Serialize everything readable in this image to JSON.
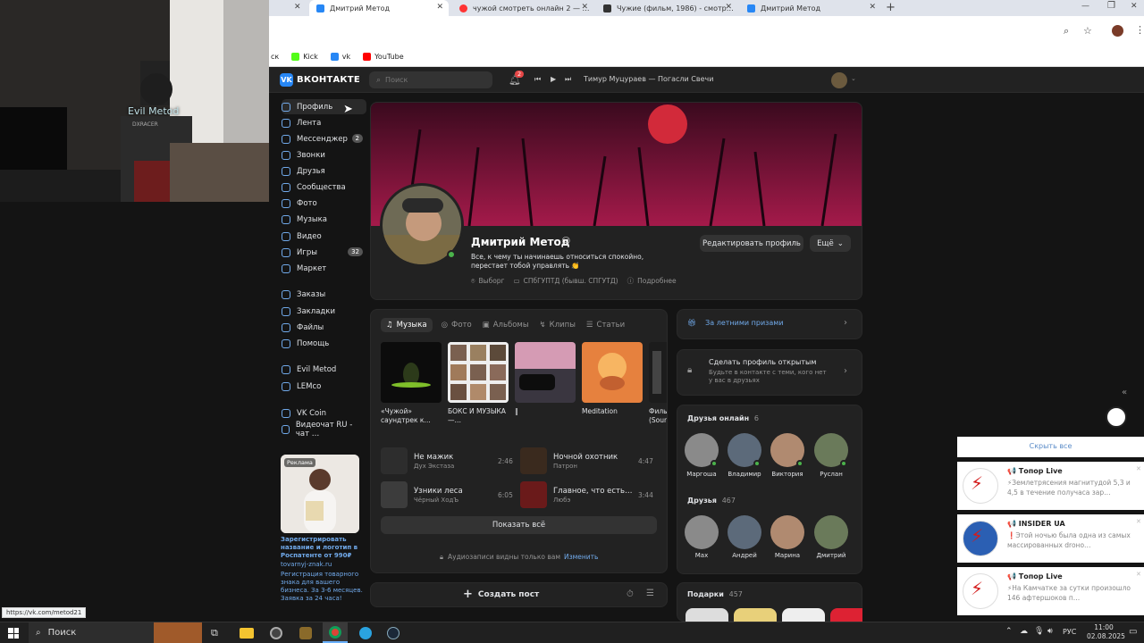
{
  "webcam": {
    "overlay_text": "Evil Metod",
    "chair_text": "DXRACER"
  },
  "browser": {
    "tabs": [
      {
        "label": "Дмитрий Метод",
        "active": true
      },
      {
        "label": "чужой смотреть онлайн 2 — …",
        "active": false
      },
      {
        "label": "Чужие (фильм, 1986) - смотр…",
        "active": false
      },
      {
        "label": "Дмитрий Метод",
        "active": false
      }
    ],
    "bookmarks": [
      {
        "label": "ск"
      },
      {
        "label": "Kick"
      },
      {
        "label": "vk"
      },
      {
        "label": "YouTube"
      }
    ],
    "status_url": "https://vk.com/metod21"
  },
  "vk": {
    "logo": "ВКОНТАКТЕ",
    "search_placeholder": "Поиск",
    "notif_count": "2",
    "now_playing": "Тимур Муцураев — Погасли Свечи",
    "nav": [
      {
        "label": "Профиль",
        "icon": "user-icon",
        "badge": ""
      },
      {
        "label": "Лента",
        "icon": "feed-icon",
        "badge": ""
      },
      {
        "label": "Мессенджер",
        "icon": "message-icon",
        "badge": "2"
      },
      {
        "label": "Звонки",
        "icon": "phone-icon",
        "badge": ""
      },
      {
        "label": "Друзья",
        "icon": "friends-icon",
        "badge": ""
      },
      {
        "label": "Сообщества",
        "icon": "groups-icon",
        "badge": ""
      },
      {
        "label": "Фото",
        "icon": "photo-icon",
        "badge": ""
      },
      {
        "label": "Музыка",
        "icon": "music-icon",
        "badge": ""
      },
      {
        "label": "Видео",
        "icon": "video-icon",
        "badge": ""
      },
      {
        "label": "Игры",
        "icon": "games-icon",
        "badge": "32"
      },
      {
        "label": "Маркет",
        "icon": "market-icon",
        "badge": ""
      },
      {
        "label": "Заказы",
        "icon": "orders-icon",
        "badge": ""
      },
      {
        "label": "Закладки",
        "icon": "bookmark-icon",
        "badge": ""
      },
      {
        "label": "Файлы",
        "icon": "files-icon",
        "badge": ""
      },
      {
        "label": "Помощь",
        "icon": "help-icon",
        "badge": ""
      },
      {
        "label": "Evil Metod",
        "icon": "community-icon",
        "badge": ""
      },
      {
        "label": "LEMco",
        "icon": "community-icon",
        "badge": ""
      },
      {
        "label": "VK Coin",
        "icon": "app-icon",
        "badge": ""
      },
      {
        "label": "Видеочат RU - чат …",
        "icon": "app-icon",
        "badge": ""
      }
    ],
    "ad": {
      "badge": "Реклама",
      "title": "Зарегистрировать название и логотип в Роспатенте от 990₽",
      "domain": "tovarnyj-znak.ru",
      "text": "Регистрация товарного знака для вашего бизнеса. За 3-6 месяцев. Заявка за 24 часа!"
    },
    "profile": {
      "name": "Дмитрий Метод",
      "status": "Все, к чему ты начинаешь относиться спокойно, перестает тобой управлять 👏",
      "city": "Выборг",
      "university": "СПбГУПТД (бывш. СПГУТД)",
      "details": "Подробнее",
      "edit_button": "Редактировать профиль",
      "more_button": "Ещё"
    },
    "media": {
      "tabs": [
        "Музыка",
        "Фото",
        "Альбомы",
        "Клипы",
        "Статьи"
      ],
      "albums": [
        {
          "title": "«Чужой» саундтрек к…"
        },
        {
          "title": "БОКС И МУЗЫКА—…"
        },
        {
          "title": "‖"
        },
        {
          "title": "Meditation"
        },
        {
          "title": "Филь (Soun"
        }
      ],
      "tracks": [
        {
          "title": "Не мажик",
          "artist": "Дух Экстаза",
          "duration": "2:46"
        },
        {
          "title": "Ночной охотник",
          "artist": "Патрон",
          "duration": "4:47"
        },
        {
          "title": "Узники леса",
          "artist": "Чёрный ХодЪ",
          "duration": "6:05"
        },
        {
          "title": "Главное, что есть…",
          "artist": "Любэ",
          "duration": "3:44"
        }
      ],
      "show_all": "Показать всё",
      "private_note": "Аудиозаписи видны только вам",
      "change": "Изменить"
    },
    "create_post": "Создать пост",
    "right": {
      "prizes": "За летними призами",
      "open_profile_title": "Сделать профиль открытым",
      "open_profile_text": "Будьте в контакте с теми, кого нет у вас в друзьях",
      "friends_online_label": "Друзья онлайн",
      "friends_online_count": "6",
      "friends_online": [
        "Маргоша",
        "Владимир",
        "Виктория",
        "Руслан"
      ],
      "friends_label": "Друзья",
      "friends_count": "467",
      "friends": [
        "Max",
        "Андрей",
        "Марина",
        "Дмитрий"
      ],
      "gifts_label": "Подарки",
      "gifts_count": "457"
    }
  },
  "notifications": {
    "hide_all": "Скрыть все",
    "items": [
      {
        "channel": "📢 Топор Live",
        "text": "⚡Землетрясения магнитудой 5,3 и 4,5 в течение получаса зар…"
      },
      {
        "channel": "📢 INSIDER UA",
        "text": "❗Этой ночью была одна из самых массированных droнo…"
      },
      {
        "channel": "📢 Топор Live",
        "text": "⚡На Камчатке за сутки произошло 146 афтершоков п…"
      }
    ]
  },
  "taskbar": {
    "search": "Поиск",
    "lang": "РУС",
    "time": "11:00",
    "date": "02.08.2025"
  },
  "colors": {
    "accent": "#71aaeb",
    "bg": "#141414",
    "card": "#222222",
    "online": "#4bb34b"
  }
}
